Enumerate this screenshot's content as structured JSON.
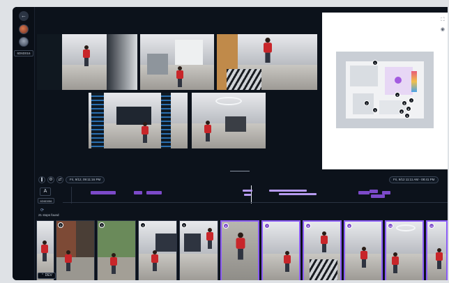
{
  "sidebar": {
    "back_icon": "arrow-left-icon",
    "tag": "6D6D016"
  },
  "controls": {
    "start_time": "Fri, 9/12, 09:11:16 PM",
    "end_time": "Fri, 9/12 11:11 AM - 08:41 PM",
    "pause_icon": "pause-icon",
    "settings_icon": "gear-icon",
    "expand_icon": "expand-icon"
  },
  "person": {
    "letter": "A",
    "id": "6D6D056"
  },
  "stops": {
    "label": "21 stops found"
  },
  "map": {
    "fullscreen_icon": "fullscreen-icon",
    "visibility_icon": "eye-icon"
  },
  "thumbnails": [
    {
      "num": "1"
    },
    {
      "num": "2"
    },
    {
      "num": "3"
    },
    {
      "num": "4"
    },
    {
      "num": "5"
    },
    {
      "num": "6"
    },
    {
      "num": "7"
    },
    {
      "num": "8"
    },
    {
      "num": "9"
    },
    {
      "num": "10"
    },
    {
      "num": "11"
    }
  ],
  "map_pins": [
    "1",
    "2",
    "3",
    "4",
    "5",
    "6",
    "7",
    "8",
    "9",
    "10",
    "11"
  ],
  "badge": {
    "label": "DEV"
  },
  "colors": {
    "accent": "#7c4ac9",
    "person_shirt": "#c8262a",
    "background": "#0c121b"
  }
}
